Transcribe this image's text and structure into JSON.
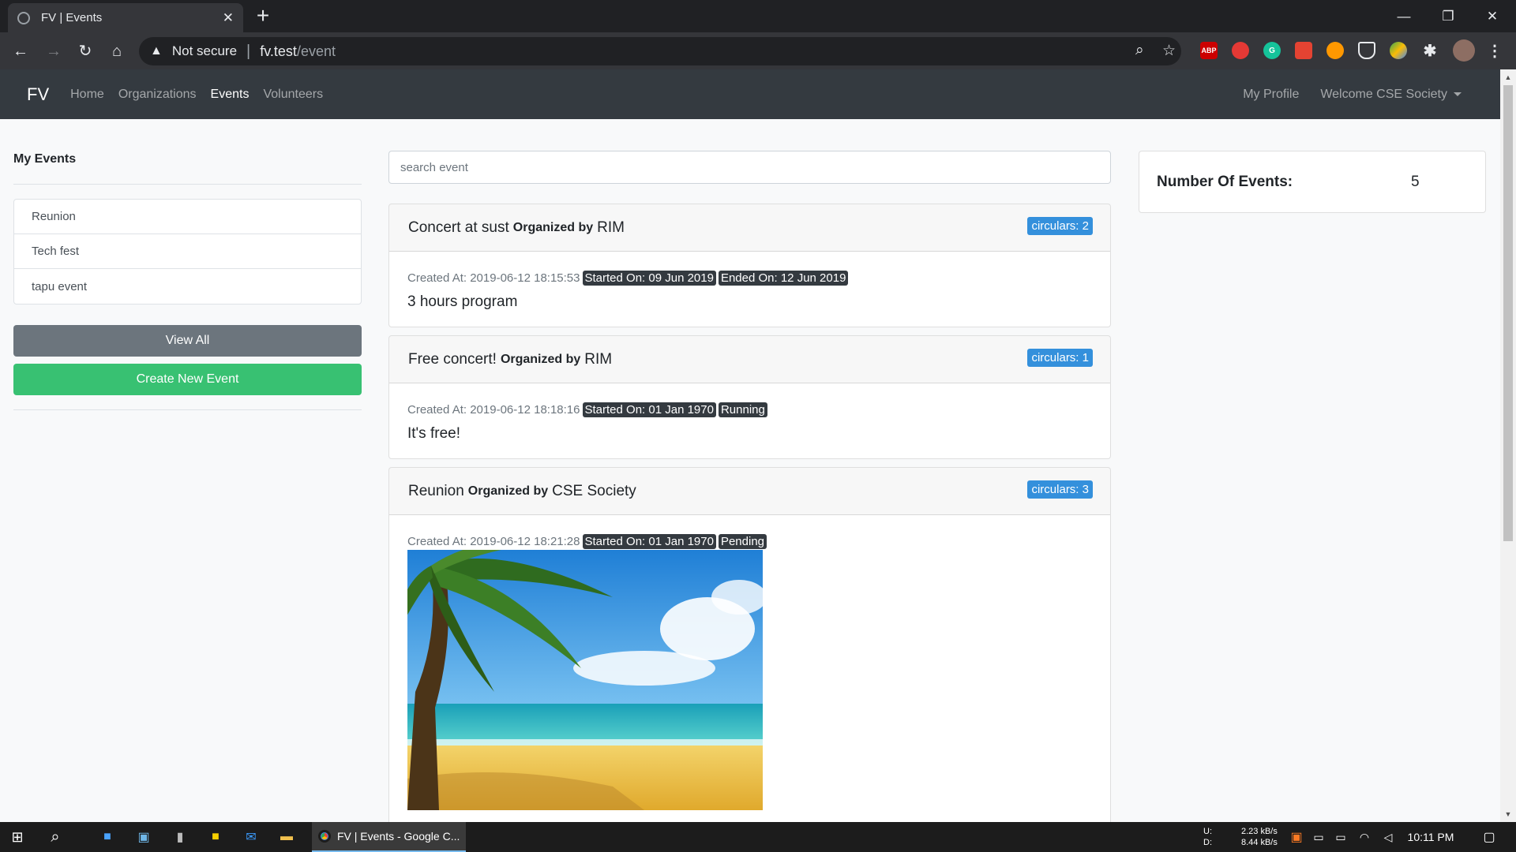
{
  "browser": {
    "tab_title": "FV | Events",
    "new_tab": "+",
    "security": "Not secure",
    "url_host": "fv.test",
    "url_path": "/event",
    "extensions": [
      "ABP",
      "",
      "G",
      "",
      "",
      "",
      "",
      ""
    ]
  },
  "nav": {
    "brand": "FV",
    "links": [
      "Home",
      "Organizations",
      "Events",
      "Volunteers"
    ],
    "active": "Events",
    "profile": "My Profile",
    "welcome": "Welcome CSE Society"
  },
  "sidebar": {
    "heading": "My Events",
    "items": [
      "Reunion",
      "Tech fest",
      "tapu event"
    ],
    "view_all": "View All",
    "create": "Create New Event"
  },
  "search": {
    "placeholder": "search event"
  },
  "events": [
    {
      "title": "Concert at sust",
      "organized_by": "Organized by",
      "organizer": "RIM",
      "circulars": "circulars: 2",
      "created": "Created At: 2019-06-12 18:15:53",
      "started": "Started On: 09 Jun 2019",
      "status": "Ended On: 12 Jun 2019",
      "description": "3 hours program"
    },
    {
      "title": "Free concert!",
      "organized_by": "Organized by",
      "organizer": "RIM",
      "circulars": "circulars: 1",
      "created": "Created At: 2019-06-12 18:18:16",
      "started": "Started On: 01 Jan 1970",
      "status": "Running",
      "description": "It's free!"
    },
    {
      "title": "Reunion",
      "organized_by": "Organized by",
      "organizer": "CSE Society",
      "circulars": "circulars: 3",
      "created": "Created At: 2019-06-12 18:21:28",
      "started": "Started On: 01 Jan 1970",
      "status": "Pending"
    }
  ],
  "stats": {
    "label": "Number Of Events:",
    "count": "5"
  },
  "taskbar": {
    "chrome_label": "FV | Events - Google C...",
    "net_up_label": "U:",
    "net_down_label": "D:",
    "net_up": "2.23 kB/s",
    "net_down": "8.44 kB/s",
    "time": "10:11 PM"
  },
  "colors": {
    "primary": "#3490dc",
    "success": "#38c172",
    "dark": "#343a40",
    "secondary": "#6c757d"
  }
}
